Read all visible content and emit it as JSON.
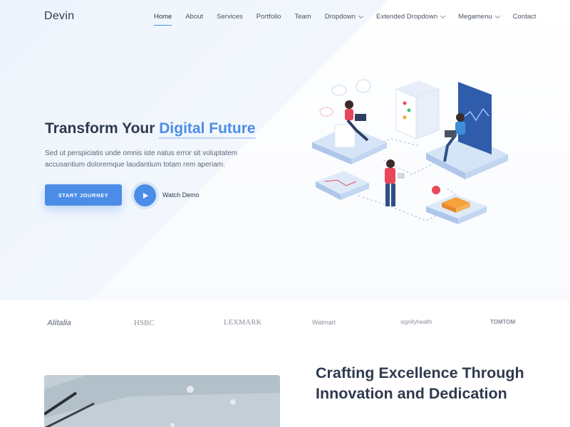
{
  "header": {
    "logo": "Devin",
    "nav": [
      {
        "label": "Home",
        "active": true,
        "dropdown": false
      },
      {
        "label": "About",
        "active": false,
        "dropdown": false
      },
      {
        "label": "Services",
        "active": false,
        "dropdown": false
      },
      {
        "label": "Portfolio",
        "active": false,
        "dropdown": false
      },
      {
        "label": "Team",
        "active": false,
        "dropdown": false
      },
      {
        "label": "Dropdown",
        "active": false,
        "dropdown": true
      },
      {
        "label": "Extended Dropdown",
        "active": false,
        "dropdown": true
      },
      {
        "label": "Megamenu",
        "active": false,
        "dropdown": true
      },
      {
        "label": "Contact",
        "active": false,
        "dropdown": false
      }
    ]
  },
  "hero": {
    "title_start": "Transform Your ",
    "title_accent": "Digital Future",
    "subtitle": "Sed ut perspiciatis unde omnis iste natus error sit voluptatem accusantium doloremque laudantium totam rem aperiam.",
    "cta_label": "START JOURNEY",
    "watch_label": "Watch Demo"
  },
  "brands": [
    "Alitalia",
    "HSBC",
    "LEXMARK",
    "Walmart",
    "signifyhealth",
    "TOMTOM"
  ],
  "about": {
    "title": "Crafting Excellence Through Innovation and Dedication"
  },
  "colors": {
    "accent": "#4b8de6",
    "heading": "#2f3a4e",
    "text": "#5e6778",
    "brand_gray": "#8a909b"
  },
  "icons": [
    "chevron-down-icon",
    "play-icon"
  ]
}
